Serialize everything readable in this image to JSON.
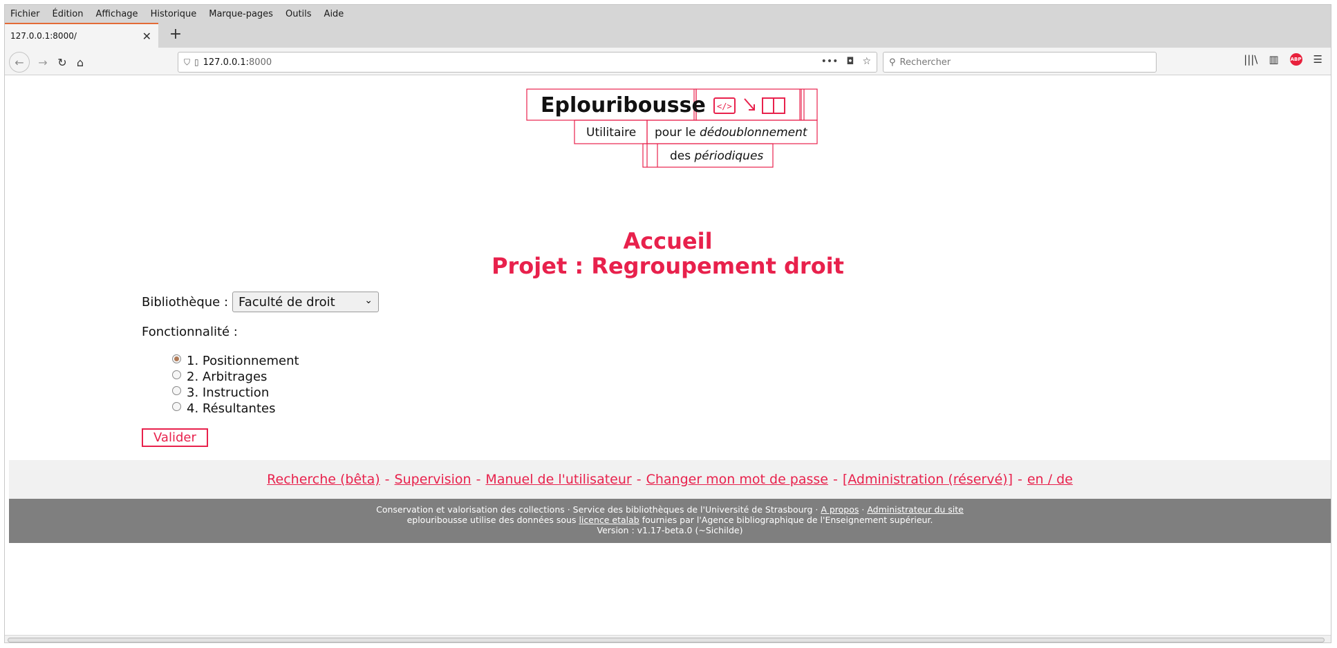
{
  "browser": {
    "menu": [
      "Fichier",
      "Édition",
      "Affichage",
      "Historique",
      "Marque-pages",
      "Outils",
      "Aide"
    ],
    "tab_title": "127.0.0.1:8000/",
    "url_host": "127.0.0.1:",
    "url_port": "8000",
    "search_placeholder": "Rechercher"
  },
  "logo": {
    "name": "Eplouribousse",
    "line1": "Utilitaire",
    "line2_a": "pour le ",
    "line2_b": "dédoublonnement",
    "line3_a": "des ",
    "line3_b": "périodiques"
  },
  "page": {
    "title": "Accueil",
    "project": "Projet : Regroupement droit",
    "library_label": "Bibliothèque :",
    "library_selected": "Faculté de droit",
    "function_label": "Fonctionnalité :",
    "options": [
      {
        "label": "1. Positionnement",
        "checked": true
      },
      {
        "label": "2. Arbitrages",
        "checked": false
      },
      {
        "label": "3. Instruction",
        "checked": false
      },
      {
        "label": "4. Résultantes",
        "checked": false
      }
    ],
    "submit": "Valider"
  },
  "footer": {
    "links": [
      "Recherche (bêta)",
      "Supervision",
      "Manuel de l'utilisateur",
      "Changer mon mot de passe",
      "[Administration (réservé)]",
      "en / de"
    ],
    "separator": "-",
    "line1_text": "Conservation et valorisation des collections · Service des bibliothèques de l'Université de Strasbourg · ",
    "line1_link1": "A propos",
    "line1_mid": " · ",
    "line1_link2": "Administrateur du site",
    "line2_a": "eplouribousse utilise des données sous ",
    "line2_link": "licence etalab",
    "line2_b": " fournies par l'Agence bibliographique de l'Enseignement supérieur.",
    "line3": "Version : v1.17-beta.0 (~Sichilde)"
  },
  "colors": {
    "accent": "#e8214c",
    "footer_gray": "#7f7f7f"
  }
}
